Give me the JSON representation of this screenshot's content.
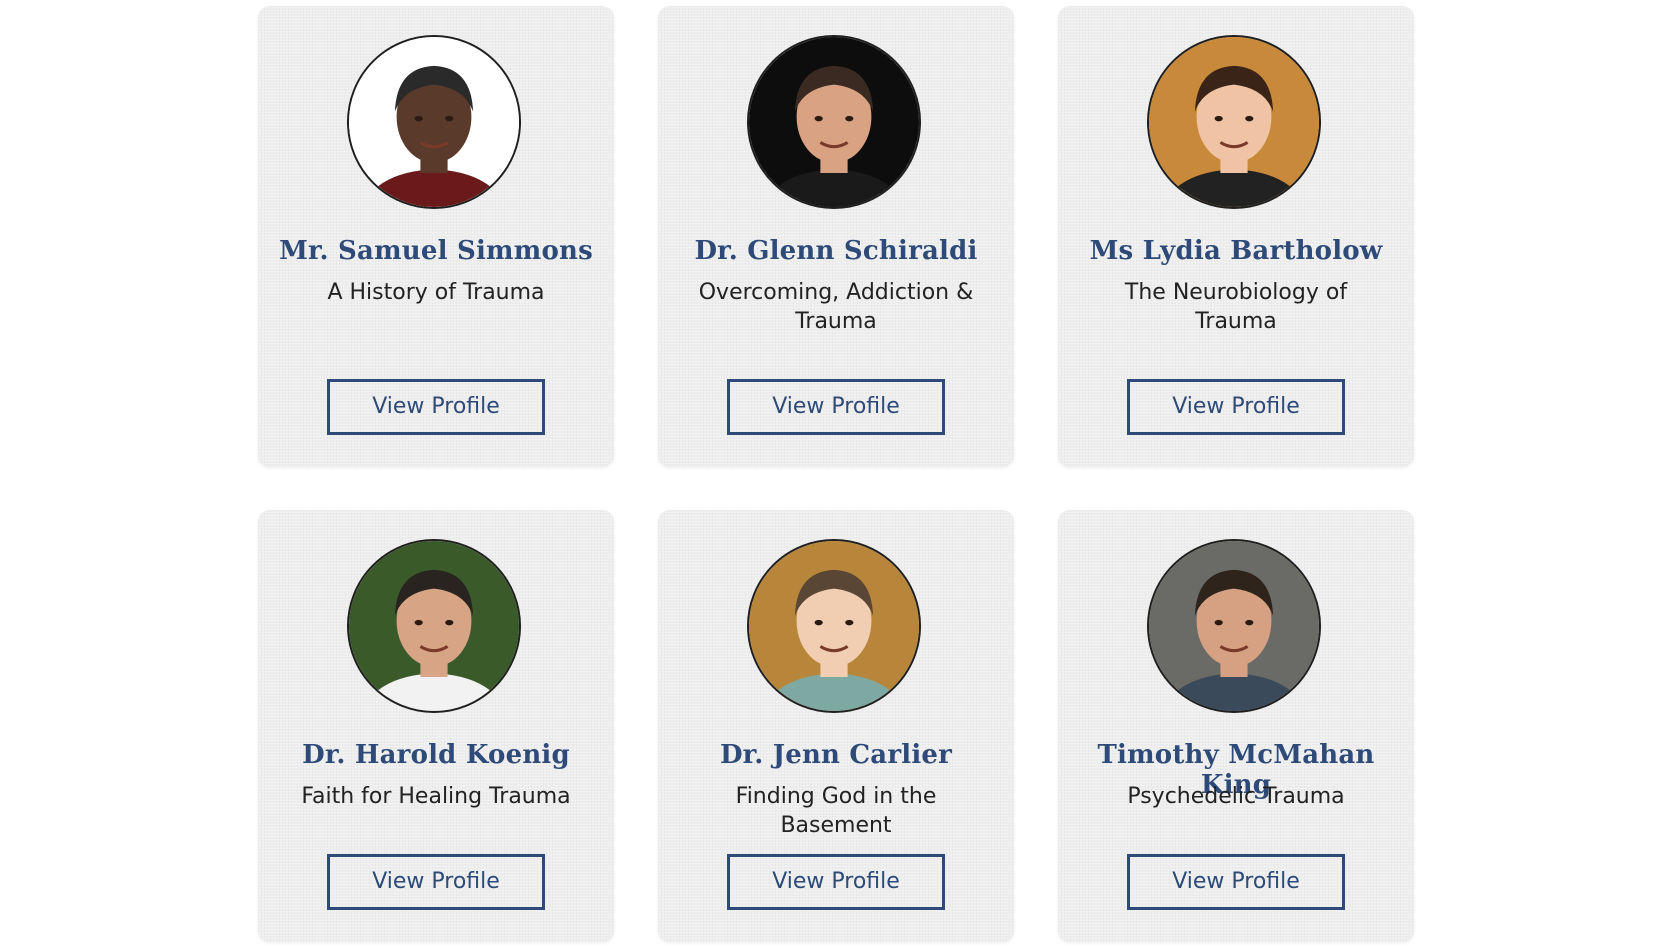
{
  "speakers": [
    {
      "name": "Mr. Samuel Simmons",
      "topic": "A History of Trauma",
      "button_label": "View Profile",
      "avatar": {
        "bg": "#ffffff",
        "skin": "#5a3a2a",
        "hair": "#2a2a2a",
        "shirt": "#6a1a1a"
      }
    },
    {
      "name": "Dr. Glenn Schiraldi",
      "topic": "Overcoming, Addiction & Trauma",
      "button_label": "View Profile",
      "avatar": {
        "bg": "#0d0d0d",
        "skin": "#d9a383",
        "hair": "#3a2a22",
        "shirt": "#1a1a1a"
      }
    },
    {
      "name": "Ms Lydia Bartholow",
      "topic": "The Neurobiology of Trauma",
      "button_label": "View Profile",
      "avatar": {
        "bg": "#c8893a",
        "skin": "#efc3a4",
        "hair": "#3a2418",
        "shirt": "#222222"
      }
    },
    {
      "name": "Dr. Harold Koenig",
      "topic": "Faith for Healing Trauma",
      "button_label": "View Profile",
      "avatar": {
        "bg": "#3a5a2a",
        "skin": "#d7a585",
        "hair": "#2a2420",
        "shirt": "#f2f2f2"
      }
    },
    {
      "name": "Dr. Jenn Carlier",
      "topic": "Finding God in the Basement",
      "button_label": "View Profile",
      "avatar": {
        "bg": "#b8863a",
        "skin": "#f1cdb1",
        "hair": "#5a4634",
        "shirt": "#7da9a2"
      }
    },
    {
      "name": "Timothy McMahan King",
      "topic": "Psychedelic Trauma",
      "button_label": "View Profile",
      "avatar": {
        "bg": "#6a6a66",
        "skin": "#d6a182",
        "hair": "#2e241c",
        "shirt": "#3a4a5a"
      }
    }
  ]
}
